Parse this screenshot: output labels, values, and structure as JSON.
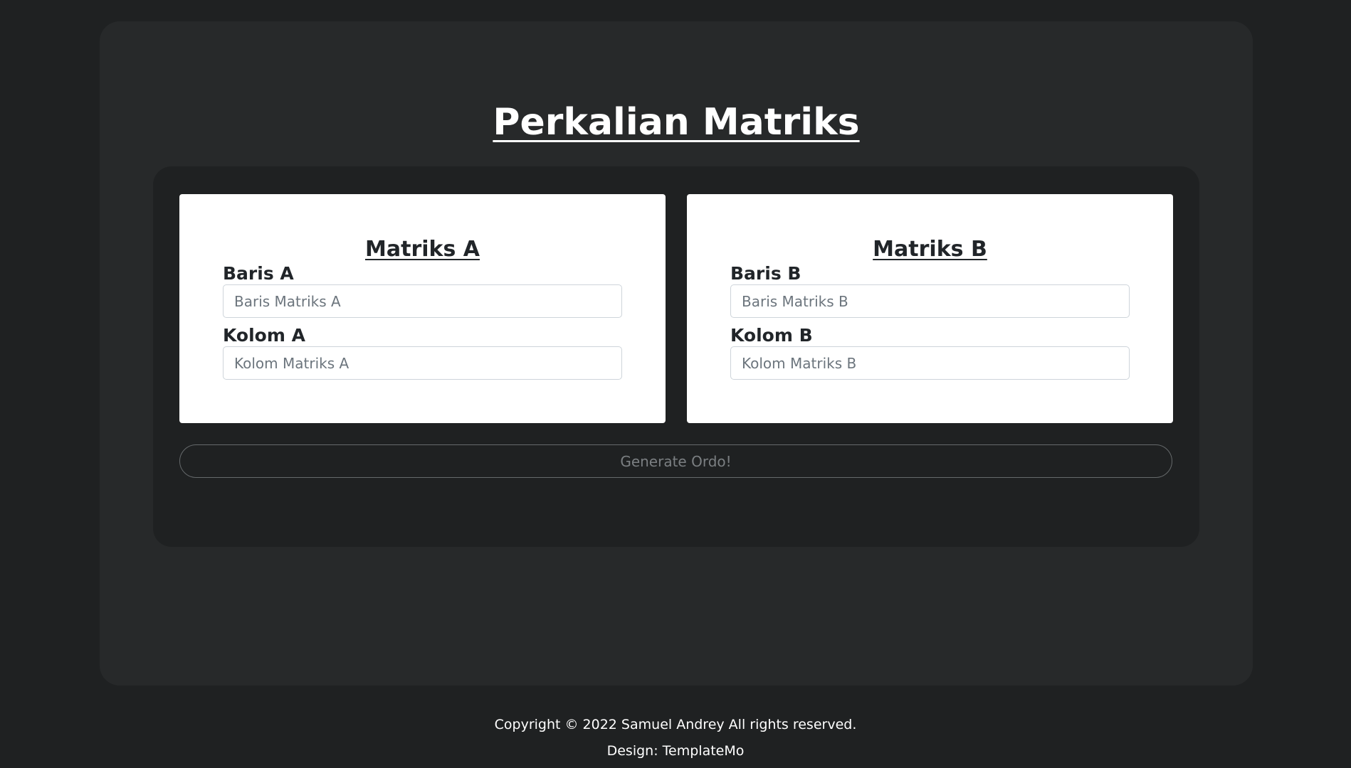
{
  "page": {
    "title": "Perkalian Matriks"
  },
  "matrix_a": {
    "title": "Matriks A",
    "rows_label": "Baris A",
    "rows_placeholder": "Baris Matriks A",
    "rows_value": "",
    "cols_label": "Kolom A",
    "cols_placeholder": "Kolom Matriks A",
    "cols_value": ""
  },
  "matrix_b": {
    "title": "Matriks B",
    "rows_label": "Baris B",
    "rows_placeholder": "Baris Matriks B",
    "rows_value": "",
    "cols_label": "Kolom B",
    "cols_placeholder": "Kolom Matriks B",
    "cols_value": ""
  },
  "actions": {
    "generate_label": "Generate Ordo!"
  },
  "footer": {
    "copyright": "Copyright © 2022 Samuel Andrey All rights reserved.",
    "design": "Design: TemplateMo"
  },
  "colors": {
    "page_background": "#1f2122",
    "panel_background": "#27292a",
    "card_background": "#ffffff",
    "text_dark": "#212529",
    "text_light": "#ffffff"
  }
}
